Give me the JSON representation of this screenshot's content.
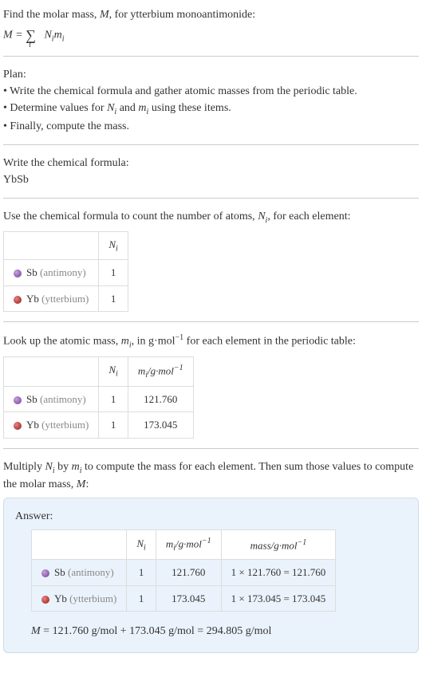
{
  "intro": {
    "line1": "Find the molar mass, ",
    "M": "M",
    "line1b": ", for ytterbium monoantimonide:",
    "formula_prefix": "M = ",
    "formula_sum_sub": "i",
    "formula_terms": " N",
    "formula_terms_sub": "i",
    "formula_terms2": "m",
    "formula_terms2_sub": "i"
  },
  "plan": {
    "heading": "Plan:",
    "b1": "• Write the chemical formula and gather atomic masses from the periodic table.",
    "b2_a": "• Determine values for ",
    "b2_Ni": "N",
    "b2_and": " and ",
    "b2_mi": "m",
    "b2_b": " using these items.",
    "b3": "• Finally, compute the mass."
  },
  "step1": {
    "heading": "Write the chemical formula:",
    "formula": "YbSb"
  },
  "step2": {
    "heading_a": "Use the chemical formula to count the number of atoms, ",
    "heading_N": "N",
    "heading_b": ", for each element:",
    "col_N": "N",
    "elements": [
      {
        "dot": "dot-sb",
        "sym": "Sb",
        "name": " (antimony)",
        "n": "1"
      },
      {
        "dot": "dot-yb",
        "sym": "Yb",
        "name": " (ytterbium)",
        "n": "1"
      }
    ]
  },
  "step3": {
    "heading_a": "Look up the atomic mass, ",
    "heading_m": "m",
    "heading_b": ", in g·mol",
    "heading_c": " for each element in the periodic table:",
    "col_N": "N",
    "col_m": "m",
    "col_m_unit": "/g·mol",
    "rows": [
      {
        "dot": "dot-sb",
        "sym": "Sb",
        "name": " (antimony)",
        "n": "1",
        "m": "121.760"
      },
      {
        "dot": "dot-yb",
        "sym": "Yb",
        "name": " (ytterbium)",
        "n": "1",
        "m": "173.045"
      }
    ]
  },
  "step4": {
    "heading_a": "Multiply ",
    "heading_N": "N",
    "heading_b": " by ",
    "heading_m": "m",
    "heading_c": " to compute the mass for each element. Then sum those values to compute the molar mass, ",
    "heading_M": "M",
    "heading_d": ":"
  },
  "answer": {
    "label": "Answer:",
    "col_N": "N",
    "col_m": "m",
    "col_m_unit": "/g·mol",
    "col_mass": "mass/g·mol",
    "rows": [
      {
        "dot": "dot-sb",
        "sym": "Sb",
        "name": " (antimony)",
        "n": "1",
        "m": "121.760",
        "mass": "1 × 121.760 = 121.760"
      },
      {
        "dot": "dot-yb",
        "sym": "Yb",
        "name": " (ytterbium)",
        "n": "1",
        "m": "173.045",
        "mass": "1 × 173.045 = 173.045"
      }
    ],
    "final_M": "M",
    "final_eq": " = 121.760 g/mol + 173.045 g/mol = 294.805 g/mol"
  }
}
